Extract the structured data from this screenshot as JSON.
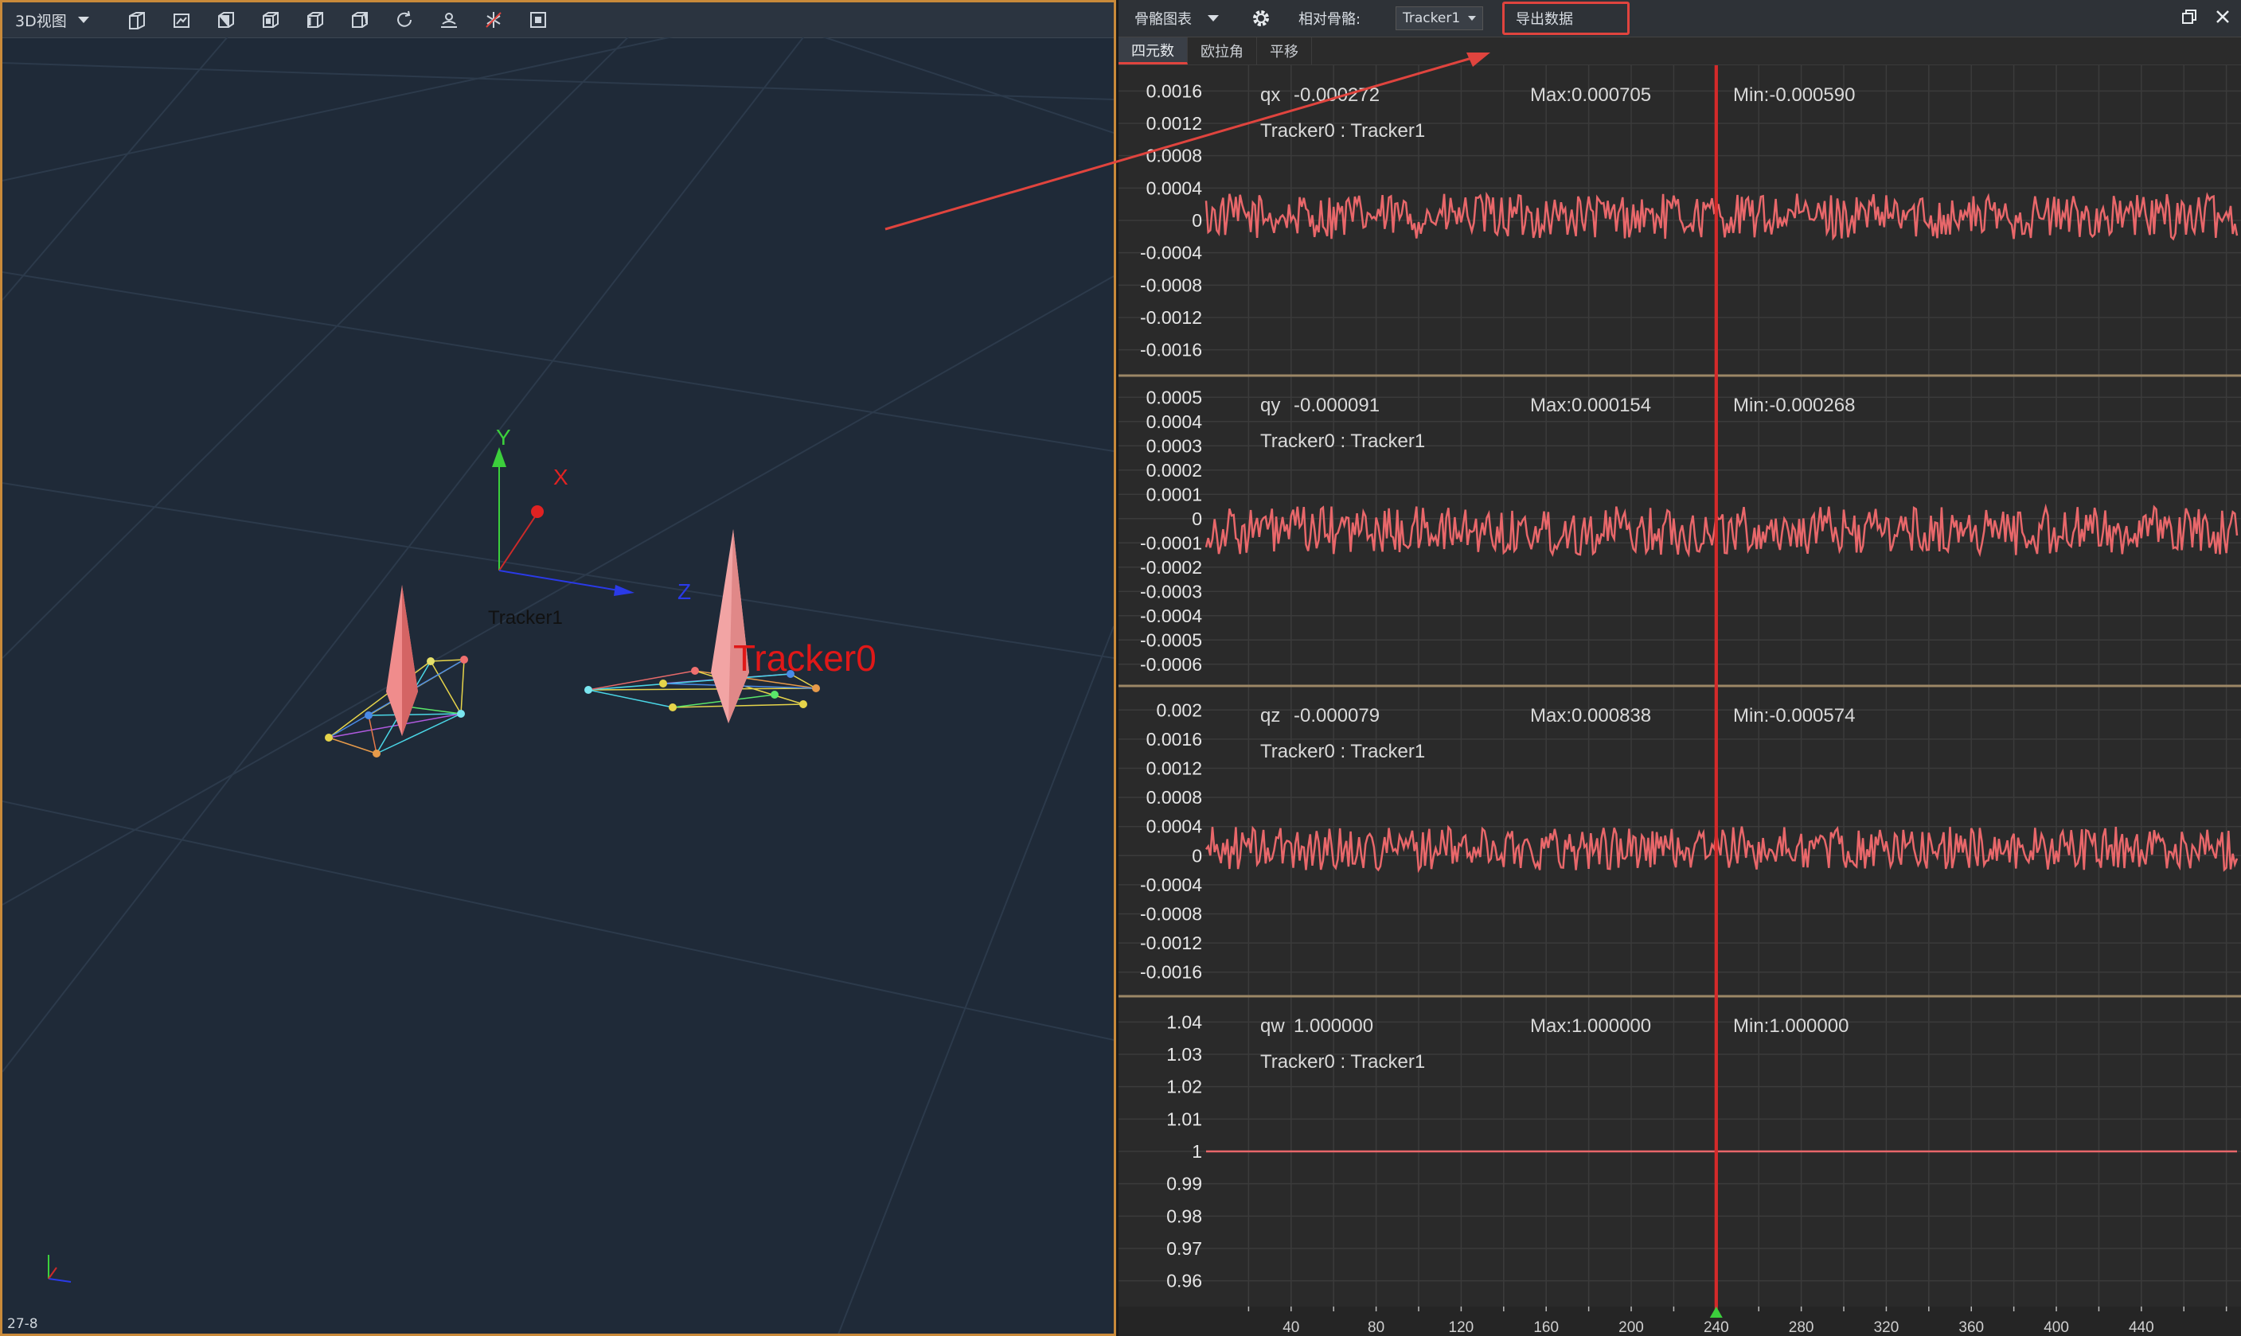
{
  "left_panel": {
    "view_label": "3D视图",
    "frame_label": "27-8",
    "axis_labels": {
      "x": "X",
      "y": "Y",
      "z": "Z"
    },
    "trackers": [
      "Tracker1",
      "Tracker0"
    ],
    "toolbar_icons": [
      "view-front-icon",
      "view-back-icon",
      "view-left-icon",
      "view-right-icon",
      "view-top-icon",
      "view-bottom-icon",
      "reset-view-icon",
      "camera-icon",
      "tracker-toggle-icon",
      "fit-view-icon"
    ]
  },
  "right_panel": {
    "chart_type_label": "骨骼图表",
    "relative_label": "相对骨骼:",
    "relative_bone": "Tracker1",
    "export_label": "导出数据",
    "tabs": [
      "四元数",
      "欧拉角",
      "平移"
    ],
    "active_tab": "四元数",
    "colors": {
      "line": "#e8676a",
      "cursor": "#d42a2a",
      "highlight": "#e0443e",
      "grid": "#3b3b3b"
    }
  },
  "chart_data": [
    {
      "type": "line",
      "series": [
        {
          "name": "qx",
          "current": "-0.000272",
          "max": "Max:0.000705",
          "min": "Min:-0.000590"
        }
      ],
      "subtitle": "Tracker0 : Tracker1",
      "yticks": [
        "0.0016",
        "0.0012",
        "0.0008",
        "0.0004",
        "0",
        "-0.0004",
        "-0.0008",
        "-0.0012",
        "-0.0016"
      ],
      "ylim": [
        -0.0018,
        0.0018
      ],
      "center": 5e-05,
      "amplitude": 0.00028
    },
    {
      "type": "line",
      "series": [
        {
          "name": "qy",
          "current": "-0.000091",
          "max": "Max:0.000154",
          "min": "Min:-0.000268"
        }
      ],
      "subtitle": "Tracker0 : Tracker1",
      "yticks": [
        "0.0005",
        "0.0004",
        "0.0003",
        "0.0002",
        "0.0001",
        "0",
        "-0.0001",
        "-0.0002",
        "-0.0003",
        "-0.0004",
        "-0.0005",
        "-0.0006"
      ],
      "ylim": [
        -0.00065,
        0.00055
      ],
      "center": -5e-05,
      "amplitude": 0.0001
    },
    {
      "type": "line",
      "series": [
        {
          "name": "qz",
          "current": "-0.000079",
          "max": "Max:0.000838",
          "min": "Min:-0.000574"
        }
      ],
      "subtitle": "Tracker0 : Tracker1",
      "yticks": [
        "0.002",
        "0.0016",
        "0.0012",
        "0.0008",
        "0.0004",
        "0",
        "-0.0004",
        "-0.0008",
        "-0.0012",
        "-0.0016"
      ],
      "ylim": [
        -0.0018,
        0.0022
      ],
      "center": 0.0001,
      "amplitude": 0.0003
    },
    {
      "type": "line",
      "series": [
        {
          "name": "qw",
          "current": "1.000000",
          "max": "Max:1.000000",
          "min": "Min:1.000000"
        }
      ],
      "subtitle": "Tracker0 : Tracker1",
      "yticks": [
        "1.04",
        "1.03",
        "1.02",
        "1.01",
        "1",
        "0.99",
        "0.98",
        "0.97",
        "0.96"
      ],
      "ylim": [
        0.955,
        1.045
      ],
      "center": 1,
      "amplitude": 0
    }
  ],
  "x_axis": {
    "ticks": [
      "40",
      "80",
      "120",
      "160",
      "200",
      "240",
      "280",
      "320",
      "360",
      "400",
      "440"
    ],
    "xlim": [
      0,
      485
    ],
    "cursor": 240,
    "samples": 485
  }
}
